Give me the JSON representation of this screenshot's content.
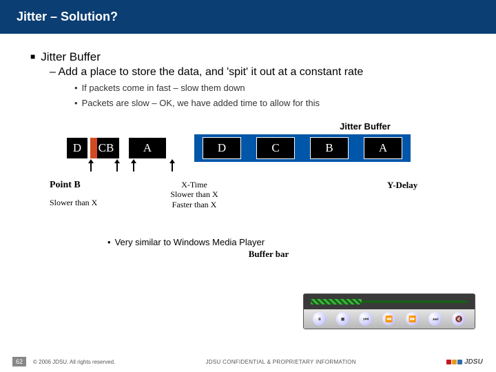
{
  "header": {
    "title": "Jitter – Solution?"
  },
  "bullets": {
    "main": "Jitter Buffer",
    "sub": "– Add a place to store the data, and 'spit' it out at a constant rate",
    "subsub1": "If packets come in fast – slow them down",
    "subsub2": "Packets are slow – OK, we have added time to allow for this"
  },
  "jitter_buffer_label": "Jitter Buffer",
  "packets_left": {
    "d": "D",
    "cb": "CB",
    "a": "A"
  },
  "packets_right": {
    "d": "D",
    "c": "C",
    "b": "B",
    "a": "A"
  },
  "labels": {
    "pointb": "Point B",
    "slower": "Slower than X",
    "xtime": "X-Time",
    "slower2": "Slower than X",
    "faster": "Faster than X",
    "ydelay": "Y-Delay"
  },
  "similar": "Very similar to Windows Media Player",
  "bufferbar": "Buffer bar",
  "footer": {
    "page": "62",
    "copyright": "© 2006 JDSU. All rights reserved.",
    "confidential": "JDSU CONFIDENTIAL & PROPRIETARY INFORMATION",
    "brand": "JDSU"
  }
}
